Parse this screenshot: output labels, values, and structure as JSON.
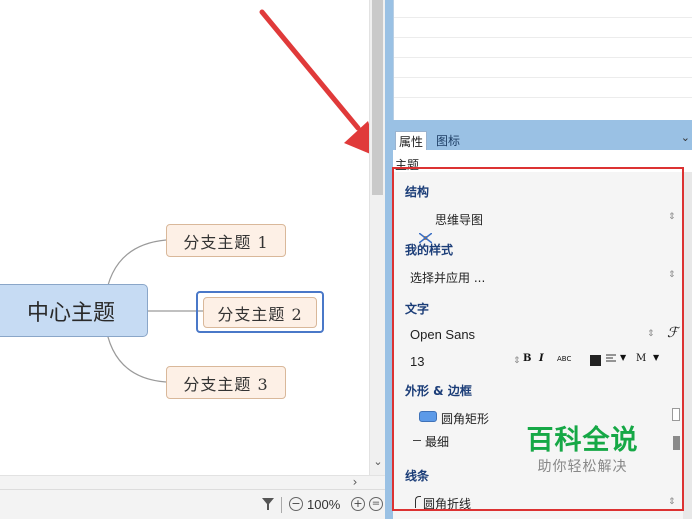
{
  "mindmap": {
    "central_topic": "中心主题",
    "branches": [
      "分支主题 1",
      "分支主题 2",
      "分支主题 3"
    ],
    "selected_branch_index": 1
  },
  "statusbar": {
    "zoom_level": "100%"
  },
  "panel": {
    "tabs": [
      "属性",
      "图标"
    ],
    "active_tab": "属性",
    "heading": "主题",
    "structure": {
      "label": "结构",
      "value": "思维导图"
    },
    "my_style": {
      "label": "我的样式",
      "value": "选择并应用 ..."
    },
    "text": {
      "label": "文字",
      "font_family": "Open Sans",
      "font_size": "13",
      "font_style_buttons": [
        "B",
        "I",
        "ABC"
      ],
      "font_script_icon": "ℱ",
      "case_button": "M"
    },
    "shape_border": {
      "label": "外形 & 边框",
      "shape": "圆角矩形",
      "border_width": "最细"
    },
    "line": {
      "label": "线条",
      "routing": "圆角折线"
    }
  },
  "watermark": {
    "title": "百科全说",
    "subtitle": "助你轻松解决"
  },
  "colors": {
    "highlight": "#dc3232",
    "central_fill": "#c6dbf3",
    "branch_fill": "#fdf0e6",
    "selection": "#4a78c8",
    "watermark_green": "#16a846",
    "panel_blue": "#9ac1e4"
  },
  "icons": {
    "arrow": "red-arrow-icon",
    "filter": "filter-icon",
    "zoom_out": "zoom-out-icon",
    "zoom_in": "zoom-in-icon",
    "zoom_fit": "zoom-fit-icon",
    "structure": "mindmap-structure-icon"
  }
}
